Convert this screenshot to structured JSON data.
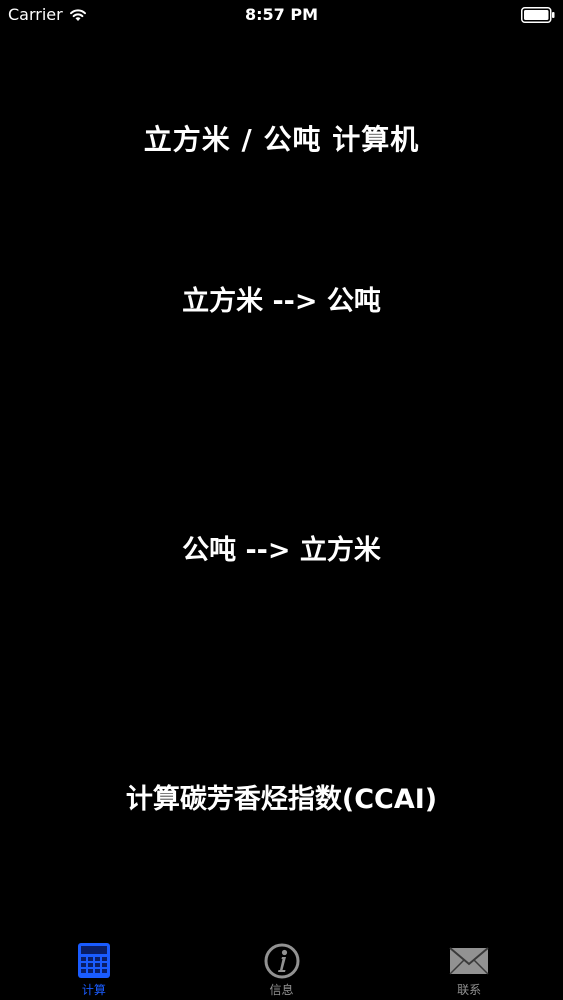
{
  "status_bar": {
    "carrier": "Carrier",
    "time": "8:57 PM"
  },
  "main": {
    "title": "立方米 / 公吨 计算机",
    "buttons": [
      {
        "label": "立方米 --> 公吨"
      },
      {
        "label": "公吨 --> 立方米"
      },
      {
        "label": "计算碳芳香烃指数(CCAI)"
      }
    ]
  },
  "tab_bar": {
    "tabs": [
      {
        "label": "计算",
        "icon": "calculator-icon",
        "active": true
      },
      {
        "label": "信息",
        "icon": "info-icon",
        "active": false
      },
      {
        "label": "联系",
        "icon": "envelope-icon",
        "active": false
      }
    ]
  },
  "colors": {
    "background": "#000000",
    "accent": "#1a5cff",
    "inactive": "#929292"
  }
}
